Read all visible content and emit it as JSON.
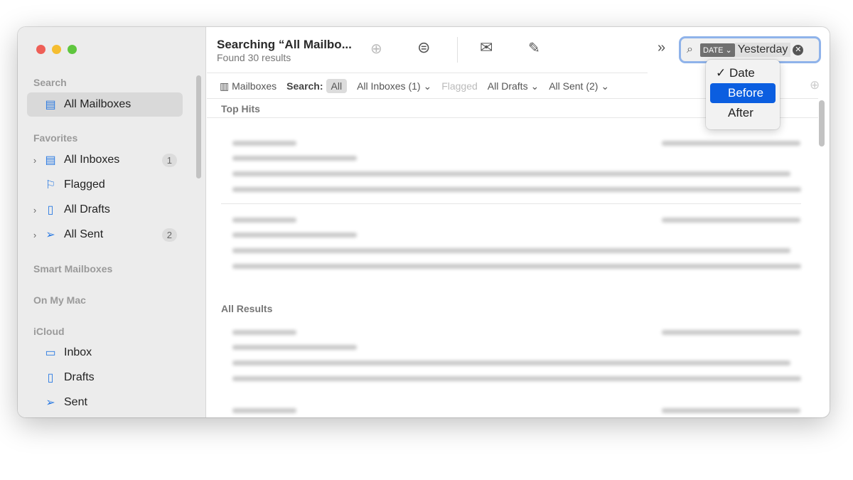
{
  "sidebar": {
    "sections": {
      "search": "Search",
      "favorites": "Favorites",
      "smart": "Smart Mailboxes",
      "onmymac": "On My Mac",
      "icloud": "iCloud"
    },
    "items": [
      {
        "label": "All Mailboxes"
      },
      {
        "label": "All Inboxes",
        "badge": "1"
      },
      {
        "label": "Flagged"
      },
      {
        "label": "All Drafts"
      },
      {
        "label": "All Sent",
        "badge": "2"
      },
      {
        "label": "Inbox"
      },
      {
        "label": "Drafts"
      },
      {
        "label": "Sent"
      }
    ]
  },
  "header": {
    "title": "Searching “All Mailbo...",
    "subtitle": "Found 30 results"
  },
  "filters": {
    "mailboxes": "Mailboxes",
    "search_label": "Search:",
    "all": "All",
    "inboxes": "All Inboxes (1)",
    "flagged": "Flagged",
    "drafts": "All Drafts",
    "sent": "All Sent (2)"
  },
  "search": {
    "token": "DATE",
    "value": "Yesterday"
  },
  "menu": {
    "items": [
      "Date",
      "Before",
      "After"
    ],
    "checked": "Date",
    "highlighted": "Before"
  },
  "results": {
    "top_hits": "Top Hits",
    "all_results": "All Results"
  },
  "colors": {
    "accent": "#0b5ee0",
    "icon": "#2a7ae2"
  }
}
